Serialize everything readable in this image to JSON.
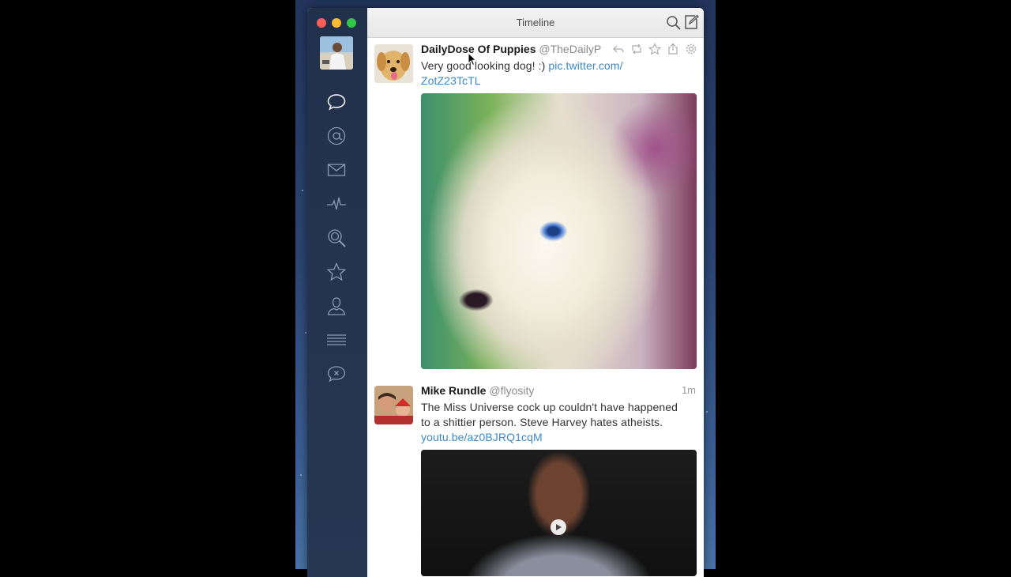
{
  "window": {
    "title": "Timeline"
  },
  "sidebar": {
    "items": [
      {
        "name": "timeline",
        "icon": "speech-bubble-icon"
      },
      {
        "name": "mentions",
        "icon": "at-sign-icon"
      },
      {
        "name": "messages",
        "icon": "envelope-icon"
      },
      {
        "name": "activity",
        "icon": "pulse-icon"
      },
      {
        "name": "search",
        "icon": "magnifier-icon"
      },
      {
        "name": "favorites",
        "icon": "star-icon"
      },
      {
        "name": "profile",
        "icon": "user-icon"
      },
      {
        "name": "lists",
        "icon": "list-icon"
      },
      {
        "name": "muted",
        "icon": "muted-bubble-icon"
      }
    ]
  },
  "colors": {
    "sidebar": "#22314b",
    "link": "#3c88c8",
    "close": "#fc5e57",
    "minimize": "#fdbc2e",
    "maximize": "#33c748"
  },
  "tweets": [
    {
      "name": "DailyDose Of Puppies",
      "handle": "@TheDailyP",
      "text": "Very good looking dog! :) ",
      "link": "pic.twitter.com/ZotZ23TcTL",
      "link_line1": "pic.twitter.com/",
      "link_line2": "ZotZ23TcTL"
    },
    {
      "name": "Mike Rundle",
      "handle": "@flyosity",
      "time": "1m",
      "text_line1": "The Miss Universe cock up couldn't have happened",
      "text_line2": "to a shittier person. Steve Harvey hates atheists.",
      "link": "youtu.be/az0BJRQ1cqM"
    }
  ]
}
